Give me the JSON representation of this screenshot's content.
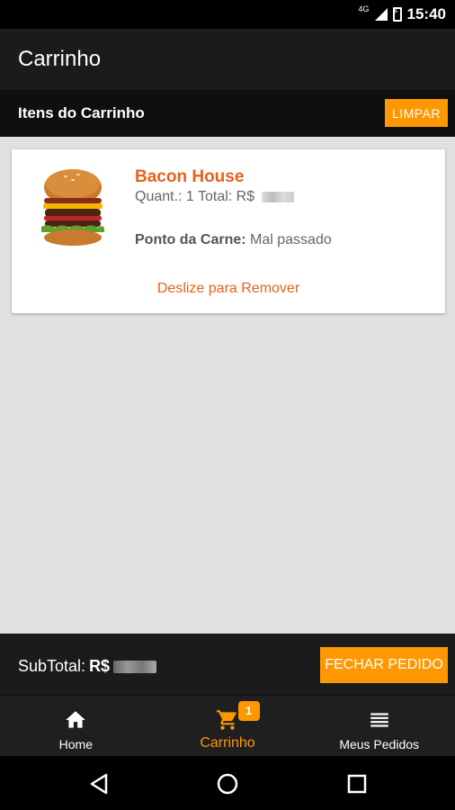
{
  "status_bar": {
    "network": "4G",
    "time": "15:40"
  },
  "app_bar": {
    "title": "Carrinho"
  },
  "section": {
    "title": "Itens do Carrinho",
    "clear_label": "LIMPAR"
  },
  "cart_items": [
    {
      "name": "Bacon House",
      "qty_label": "Quant.: 1 Total: R$",
      "doneness_label": "Ponto da Carne:",
      "doneness_value": "Mal passado",
      "swipe_hint": "Deslize para Remover"
    }
  ],
  "footer": {
    "subtotal_label": "SubTotal:",
    "currency": "R$",
    "close_order_label": "FECHAR PEDIDO"
  },
  "bottom_nav": {
    "items": [
      {
        "label": "Home",
        "icon": "home-icon"
      },
      {
        "label": "Carrinho",
        "icon": "cart-icon",
        "badge": "1",
        "active": true
      },
      {
        "label": "Meus Pedidos",
        "icon": "list-icon"
      }
    ]
  },
  "colors": {
    "accent": "#ff9800",
    "item_title": "#e8611a",
    "bar_bg": "#1b1b1b",
    "content_bg": "#e0e0e0"
  }
}
